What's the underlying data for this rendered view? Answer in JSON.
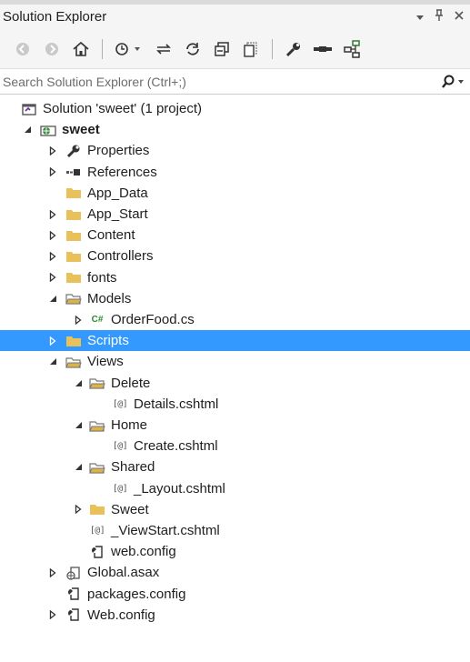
{
  "window": {
    "title": "Solution Explorer",
    "controls": [
      "dropdown-icon",
      "pin-icon",
      "close-icon"
    ]
  },
  "toolbar": {
    "buttons": [
      "back-icon",
      "forward-icon",
      "home-icon",
      "history-icon",
      "sync-icon",
      "refresh-icon",
      "collapse-all-icon",
      "show-all-files-icon",
      "properties-icon",
      "preview-icon",
      "view-class-diagram-icon"
    ]
  },
  "search": {
    "placeholder": "Search Solution Explorer (Ctrl+;)"
  },
  "colors": {
    "selection": "#3399ff",
    "folder": "#e8c15a",
    "folder_open": "#dcb24a"
  },
  "tree": [
    {
      "label": "Solution 'sweet' (1 project)",
      "icon": "solution-icon",
      "expander": "none",
      "level": 0
    },
    {
      "label": "sweet",
      "icon": "web-project-icon",
      "expander": "expanded",
      "level": 0,
      "bold": true
    },
    {
      "label": "Properties",
      "icon": "wrench-icon",
      "expander": "collapsed",
      "level": 1
    },
    {
      "label": "References",
      "icon": "references-icon",
      "expander": "collapsed",
      "level": 1
    },
    {
      "label": "App_Data",
      "icon": "folder-icon",
      "expander": "none",
      "level": 1
    },
    {
      "label": "App_Start",
      "icon": "folder-icon",
      "expander": "collapsed",
      "level": 1
    },
    {
      "label": "Content",
      "icon": "folder-icon",
      "expander": "collapsed",
      "level": 1
    },
    {
      "label": "Controllers",
      "icon": "folder-icon",
      "expander": "collapsed",
      "level": 1
    },
    {
      "label": "fonts",
      "icon": "folder-icon",
      "expander": "collapsed",
      "level": 1
    },
    {
      "label": "Models",
      "icon": "folder-open-icon",
      "expander": "expanded",
      "level": 1
    },
    {
      "label": "OrderFood.cs",
      "icon": "csharp-file-icon",
      "expander": "collapsed",
      "level": 2
    },
    {
      "label": "Scripts",
      "icon": "folder-icon",
      "expander": "collapsed",
      "level": 1,
      "selected": true
    },
    {
      "label": "Views",
      "icon": "folder-open-icon",
      "expander": "expanded",
      "level": 1
    },
    {
      "label": "Delete",
      "icon": "folder-open-icon",
      "expander": "expanded",
      "level": 2
    },
    {
      "label": "Details.cshtml",
      "icon": "razor-file-icon",
      "expander": "none",
      "level": 3
    },
    {
      "label": "Home",
      "icon": "folder-open-icon",
      "expander": "expanded",
      "level": 2
    },
    {
      "label": "Create.cshtml",
      "icon": "razor-file-icon",
      "expander": "none",
      "level": 3
    },
    {
      "label": "Shared",
      "icon": "folder-open-icon",
      "expander": "expanded",
      "level": 2
    },
    {
      "label": "_Layout.cshtml",
      "icon": "razor-file-icon",
      "expander": "none",
      "level": 3
    },
    {
      "label": "Sweet",
      "icon": "folder-icon",
      "expander": "collapsed",
      "level": 2
    },
    {
      "label": "_ViewStart.cshtml",
      "icon": "razor-file-icon",
      "expander": "none",
      "level": 2
    },
    {
      "label": "web.config",
      "icon": "config-file-icon",
      "expander": "none",
      "level": 2
    },
    {
      "label": "Global.asax",
      "icon": "global-asax-icon",
      "expander": "collapsed",
      "level": 1
    },
    {
      "label": "packages.config",
      "icon": "config-file-icon",
      "expander": "none",
      "level": 1
    },
    {
      "label": "Web.config",
      "icon": "config-file-icon",
      "expander": "collapsed",
      "level": 1
    }
  ]
}
